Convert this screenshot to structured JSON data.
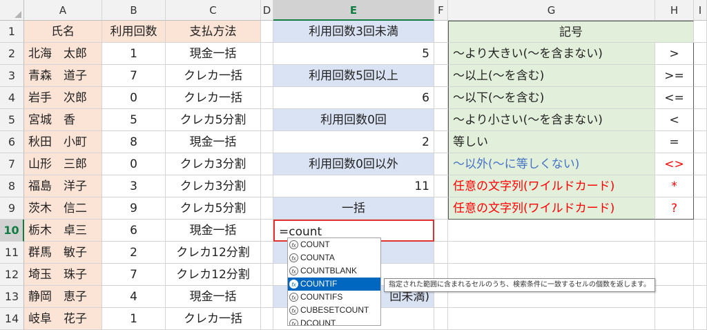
{
  "columns": [
    "A",
    "B",
    "C",
    "D",
    "E",
    "F",
    "G",
    "H",
    "I"
  ],
  "selected_column": "E",
  "rows": [
    "1",
    "2",
    "3",
    "4",
    "5",
    "6",
    "7",
    "8",
    "9",
    "10",
    "11",
    "12",
    "13",
    "14"
  ],
  "selected_row": "10",
  "table": {
    "headers": [
      "氏名",
      "利用回数",
      "支払方法"
    ],
    "records": [
      {
        "name": "北海　太郎",
        "count": "1",
        "method": "現金一括"
      },
      {
        "name": "青森　道子",
        "count": "7",
        "method": "クレカ一括"
      },
      {
        "name": "岩手　次郎",
        "count": "0",
        "method": "クレカ一括"
      },
      {
        "name": "宮城　香",
        "count": "5",
        "method": "クレカ5分割"
      },
      {
        "name": "秋田　小町",
        "count": "8",
        "method": "現金一括"
      },
      {
        "name": "山形　三郎",
        "count": "0",
        "method": "クレカ3分割"
      },
      {
        "name": "福島　洋子",
        "count": "3",
        "method": "クレカ3分割"
      },
      {
        "name": "茨木　信二",
        "count": "9",
        "method": "クレカ5分割"
      },
      {
        "name": "栃木　卓三",
        "count": "6",
        "method": "現金一括"
      },
      {
        "name": "群馬　敏子",
        "count": "2",
        "method": "クレカ12分割"
      },
      {
        "name": "埼玉　珠子",
        "count": "7",
        "method": "クレカ12分割"
      },
      {
        "name": "静岡　恵子",
        "count": "4",
        "method": "現金一括"
      },
      {
        "name": "岐阜　花子",
        "count": "1",
        "method": "クレカ一括"
      }
    ]
  },
  "col_e": {
    "r1": "利用回数3回未満",
    "r2": "5",
    "r3": "利用回数5回以上",
    "r4": "6",
    "r5": "利用回数0回",
    "r6": "2",
    "r7": "利用回数0回以外",
    "r8": "11",
    "r9": "一括",
    "r10": "=count",
    "r13_partial": "回未満)"
  },
  "symbols": {
    "header": "記号",
    "items": [
      {
        "desc": "～より大きい(～を含まない)",
        "sym": ">",
        "color": "normal"
      },
      {
        "desc": "～以上(～を含む)",
        "sym": ">=",
        "color": "normal"
      },
      {
        "desc": "～以下(～を含む)",
        "sym": "<=",
        "color": "normal"
      },
      {
        "desc": "～より小さい(～を含まない)",
        "sym": "<",
        "color": "normal"
      },
      {
        "desc": "等しい",
        "sym": "=",
        "color": "normal"
      },
      {
        "desc": "～以外(～に等しくない)",
        "sym": "<>",
        "color": "blue-red"
      },
      {
        "desc": "任意の文字列(ワイルドカード)",
        "sym": "*",
        "color": "red"
      },
      {
        "desc": "任意の文字列(ワイルドカード)",
        "sym": "?",
        "color": "red"
      }
    ]
  },
  "autocomplete": {
    "items": [
      "COUNT",
      "COUNTA",
      "COUNTBLANK",
      "COUNTIF",
      "COUNTIFS",
      "CUBESETCOUNT",
      "DCOUNT"
    ],
    "selected": "COUNTIF",
    "fx_glyph": "fx",
    "tooltip": "指定された範囲に含まれるセルのうち、検索条件に一致するセルの個数を返します。"
  },
  "colors": {
    "peach": "#fbe3d6",
    "blue": "#dae3f3",
    "green": "#e2efda",
    "red": "#ff0000",
    "link_blue": "#4472c4",
    "accent": "#107c41"
  }
}
